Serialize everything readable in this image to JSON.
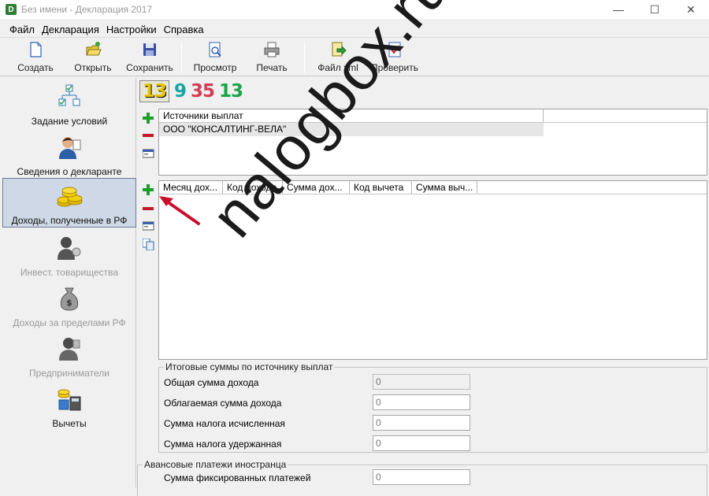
{
  "window": {
    "title": "Без имени - Декларация 2017",
    "app_icon": "D"
  },
  "menu": {
    "items": [
      "Файл",
      "Декларация",
      "Настройки",
      "Справка"
    ]
  },
  "toolbar": {
    "create": "Создать",
    "open": "Открыть",
    "save": "Сохранить",
    "preview": "Просмотр",
    "print": "Печать",
    "xml": "Файл xml",
    "check": "Проверить"
  },
  "sidebar": {
    "items": [
      {
        "label": "Задание условий",
        "icon": "conditions-icon"
      },
      {
        "label": "Сведения о декларанте",
        "icon": "declarant-icon"
      },
      {
        "label": "Доходы, полученные в РФ",
        "icon": "coins-icon"
      },
      {
        "label": "Инвест. товарищества",
        "icon": "investment-icon"
      },
      {
        "label": "Доходы за пределами РФ",
        "icon": "money-bag-icon"
      },
      {
        "label": "Предприниматели",
        "icon": "entrepreneur-icon"
      },
      {
        "label": "Вычеты",
        "icon": "deductions-icon"
      }
    ]
  },
  "tax_rates": [
    "13",
    "9",
    "35",
    "13"
  ],
  "sources": {
    "header": "Источники выплат",
    "rows": [
      "ООО \"КОНСАЛТИНГ-ВЕЛА\""
    ]
  },
  "income": {
    "columns": [
      "Месяц дох...",
      "Код дохода",
      "Сумма дох...",
      "Код вычета",
      "Сумма выч..."
    ]
  },
  "totals": {
    "title": "Итоговые суммы по источнику выплат",
    "fields": [
      {
        "label": "Общая сумма дохода",
        "value": "0"
      },
      {
        "label": "Облагаемая сумма дохода",
        "value": "0"
      },
      {
        "label": "Сумма налога исчисленная",
        "value": "0"
      },
      {
        "label": "Сумма налога удержанная",
        "value": "0"
      }
    ]
  },
  "advance": {
    "title": "Авансовые платежи иностранца",
    "fields": [
      {
        "label": "Сумма фиксированных платежей",
        "value": "0"
      }
    ]
  },
  "watermark": "nalogbox.ru",
  "colors": {
    "plus": "#1b9e2a",
    "minus": "#c0192a",
    "arrow": "#c8102e",
    "active_item": "#cfd8e6"
  }
}
